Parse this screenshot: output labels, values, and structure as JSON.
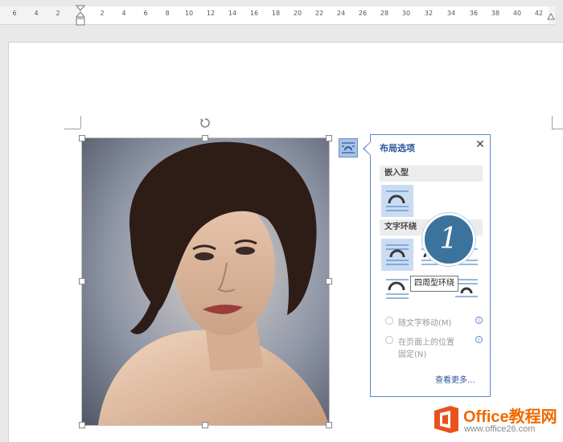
{
  "ruler": {
    "ticks": [
      "6",
      "4",
      "2",
      "2",
      "4",
      "6",
      "8",
      "10",
      "12",
      "14",
      "16",
      "18",
      "20",
      "22",
      "24",
      "26",
      "28",
      "30",
      "32",
      "34",
      "36",
      "38",
      "40",
      "42"
    ]
  },
  "layout_panel": {
    "title": "布局选项",
    "close_icon": "close-icon",
    "section_inline": "嵌入型",
    "section_wrap": "文字环绕",
    "tooltip": "四周型环绕",
    "radio_move_with_text": "随文字移动(M)",
    "radio_fix_position_line1": "在页面上的位置",
    "radio_fix_position_line2": "固定(N)",
    "see_more": "查看更多...",
    "accent_color": "#2b5797"
  },
  "callout": {
    "number": "1",
    "color": "#3b739d"
  },
  "watermark": {
    "brand": "Office教程网",
    "url": "www.office26.com"
  }
}
